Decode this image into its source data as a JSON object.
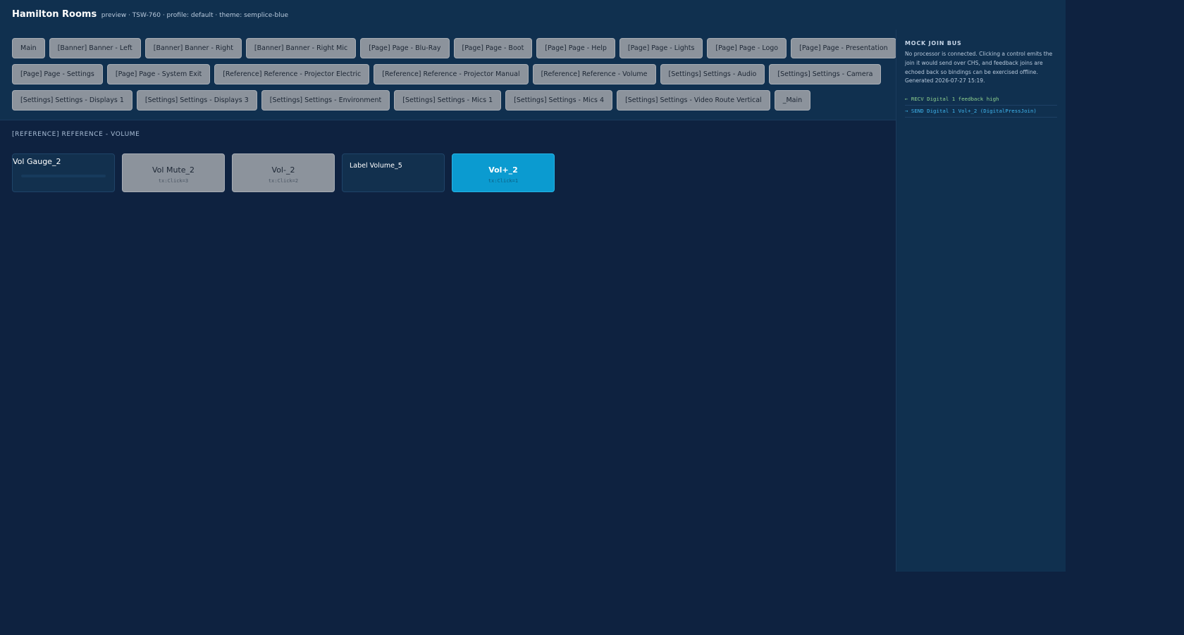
{
  "header": {
    "title": "Hamilton Rooms",
    "subtitle": "preview · TSW-760 · profile: default · theme: semplice-blue"
  },
  "nav": {
    "row1": [
      "Main",
      "[Banner] Banner - Left",
      "[Banner] Banner - Right",
      "[Banner] Banner - Right Mic",
      "[Page] Page - Blu-Ray",
      "[Page] Page - Boot",
      "[Page] Page - Help",
      "[Page] Page - Lights",
      "[Page] Page - Logo",
      "[Page] Page - Presentation"
    ],
    "row2": [
      "[Page] Page - Settings",
      "[Page] Page - System Exit",
      "[Reference] Reference - Projector Electric",
      "[Reference] Reference - Projector Manual",
      "[Reference] Reference - Volume",
      "[Settings] Settings - Audio",
      "[Settings] Settings - Camera"
    ],
    "row3": [
      "[Settings] Settings - Displays 1",
      "[Settings] Settings - Displays 3",
      "[Settings] Settings - Environment",
      "[Settings] Settings - Mics 1",
      "[Settings] Settings - Mics 4",
      "[Settings] Settings - Video Route Vertical",
      "_Main"
    ]
  },
  "page": {
    "section_title": "[REFERENCE] REFERENCE - VOLUME",
    "controls": {
      "gauge": {
        "label": "Vol Gauge_2"
      },
      "mute": {
        "label": "Vol Mute_2",
        "sub": "tx:Click=3"
      },
      "vol_down": {
        "label": "Vol-_2",
        "sub": "tx:Click=2"
      },
      "label_volume": {
        "text": "Label Volume_5"
      },
      "vol_up": {
        "label": "Vol+_2",
        "sub": "tx:Click=1"
      }
    }
  },
  "sidebar": {
    "title": "MOCK JOIN BUS",
    "description": "No processor is connected. Clicking a control emits the join it would send over CHS, and feedback joins are echoed back so bindings can be exercised offline. Generated 2026-07-27 15:19.",
    "log": [
      {
        "kind": "recv",
        "text": "← RECV Digital 1  feedback high"
      },
      {
        "kind": "send",
        "text": "→ SEND Digital 1  Vol+_2 (DigitalPressJoin)"
      }
    ]
  },
  "colors": {
    "background": "#0e2240",
    "panel": "#10304f",
    "button": "#8c939c",
    "accent": "#0b9bd0",
    "recv": "#8fd28f",
    "send": "#3fb6ef"
  }
}
